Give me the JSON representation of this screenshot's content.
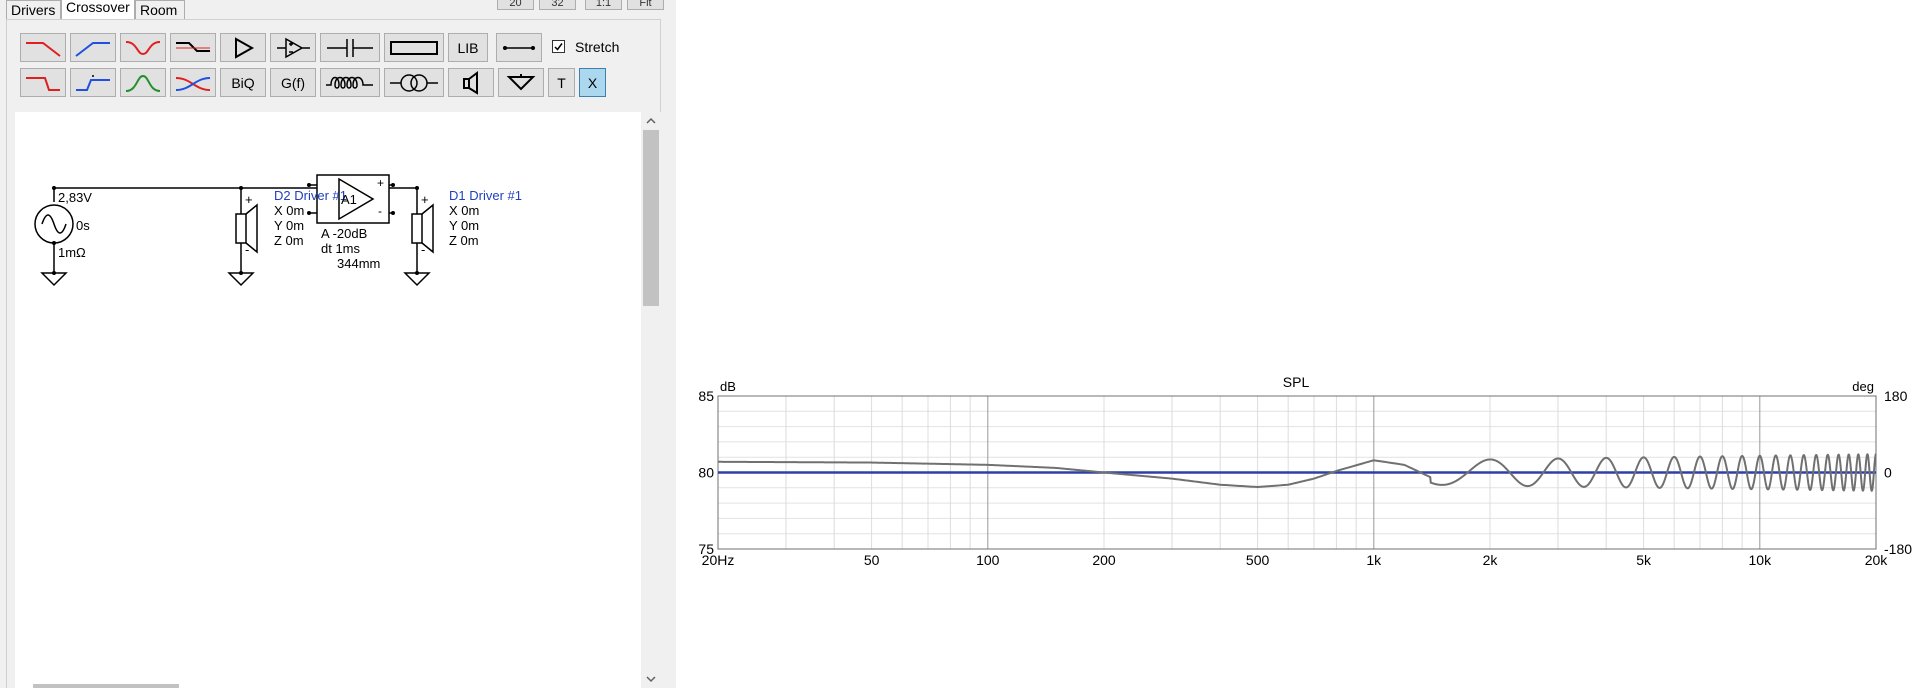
{
  "tabs": [
    {
      "label": "Drivers"
    },
    {
      "label": "Crossover"
    },
    {
      "label": "Room"
    }
  ],
  "top_buttons": [
    "20",
    "32",
    "1:1",
    "Fit"
  ],
  "toolbar": {
    "lib_label": "LIB",
    "biq_label": "BiQ",
    "gf_label": "G(f)",
    "t_label": "T",
    "x_label": "X",
    "stretch_label": "Stretch",
    "stretch_checked": true
  },
  "schematic": {
    "source": {
      "voltage": "2,83V",
      "delay": "0s",
      "resistance": "1mΩ"
    },
    "driver2": {
      "name": "D2 Driver #1",
      "x": "X 0m",
      "y": "Y 0m",
      "z": "Z 0m"
    },
    "amp": {
      "id": "A1",
      "gain": "A  -20dB",
      "dt": "dt 1ms",
      "dist": "344mm",
      "plus": "+",
      "minus": "-"
    },
    "driver1": {
      "name": "D1 Driver #1",
      "x": "X 0m",
      "y": "Y 0m",
      "z": "Z 0m"
    },
    "plus": "+",
    "minus": "-"
  },
  "chart_data": {
    "type": "line",
    "title": "SPL",
    "ylabel": "dB",
    "y2label": "deg",
    "x_scale": "log",
    "xlim": [
      20,
      20000
    ],
    "ylim": [
      75,
      85
    ],
    "y2lim": [
      -180,
      180
    ],
    "x_ticks": [
      {
        "v": 20,
        "t": "20Hz"
      },
      {
        "v": 50,
        "t": "50"
      },
      {
        "v": 100,
        "t": "100"
      },
      {
        "v": 200,
        "t": "200"
      },
      {
        "v": 500,
        "t": "500"
      },
      {
        "v": 1000,
        "t": "1k"
      },
      {
        "v": 2000,
        "t": "2k"
      },
      {
        "v": 5000,
        "t": "5k"
      },
      {
        "v": 10000,
        "t": "10k"
      },
      {
        "v": 20000,
        "t": "20k"
      }
    ],
    "y_ticks": [
      {
        "v": 85,
        "t": "85"
      },
      {
        "v": 80,
        "t": "80"
      },
      {
        "v": 75,
        "t": "75"
      }
    ],
    "y2_ticks": [
      {
        "v": 180,
        "t": "180"
      },
      {
        "v": 0,
        "t": "0"
      },
      {
        "v": -180,
        "t": "-180"
      }
    ],
    "grid": true,
    "series": [
      {
        "values_desc": "gray SPL curve",
        "color": "#707070",
        "x": [
          20,
          50,
          100,
          150,
          200,
          300,
          400,
          500,
          600,
          700,
          800,
          1000,
          1200,
          1400,
          1600,
          2000
        ],
        "y": [
          80.7,
          80.65,
          80.5,
          80.3,
          80.0,
          79.6,
          79.2,
          79.05,
          79.2,
          79.6,
          80.1,
          80.8,
          80.5,
          79.7,
          79.3,
          80.8
        ]
      },
      {
        "values_desc": "blue phase line",
        "color": "#2f3fa8",
        "x": [
          20,
          20000
        ],
        "y": [
          80,
          80
        ]
      }
    ],
    "comb": {
      "start_hz": 1400,
      "end_hz": 20000,
      "center": 80,
      "amp_db_min": 0.8,
      "amp_db_max": 1.2
    }
  }
}
